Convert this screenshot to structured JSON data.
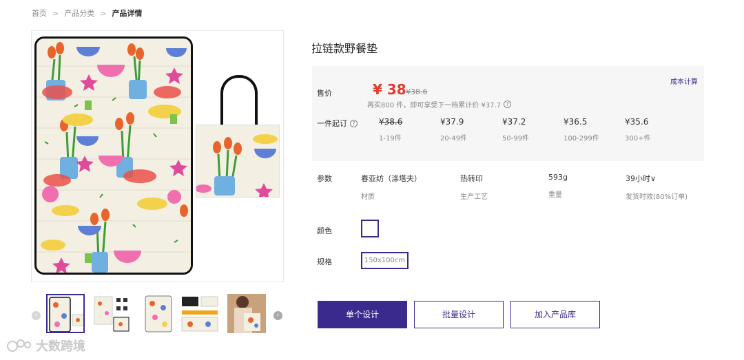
{
  "breadcrumb": {
    "home": "首页",
    "category": "产品分类",
    "current": "产品详情",
    "separator": ">"
  },
  "product": {
    "title": "拉链款野餐垫"
  },
  "price": {
    "label": "售价",
    "currency": "¥",
    "current": "38",
    "original": "38.6",
    "note": "再买800 件，即可享受下一档累计价 ¥37.7",
    "cost_link": "成本计算",
    "moq_label": "一件起订",
    "tiers": [
      {
        "price": "¥38.6",
        "qty": "1-19件"
      },
      {
        "price": "¥37.9",
        "qty": "20-49件"
      },
      {
        "price": "¥37.2",
        "qty": "50-99件"
      },
      {
        "price": "¥36.5",
        "qty": "100-299件"
      },
      {
        "price": "¥35.6",
        "qty": "300+件"
      }
    ]
  },
  "params": {
    "label": "参数",
    "items": [
      {
        "value": "春亚纺（涤塔夫）",
        "key": "材质"
      },
      {
        "value": "热转印",
        "key": "生产工艺"
      },
      {
        "value": "593g",
        "key": "重量"
      },
      {
        "value": "39小时∨",
        "key": "发货时效(80%订单)"
      }
    ]
  },
  "color": {
    "label": "颜色"
  },
  "spec": {
    "label": "规格",
    "option": "150x100cm"
  },
  "buttons": {
    "single_design": "单个设计",
    "batch_design": "批量设计",
    "add_library": "加入产品库"
  },
  "watermark": {
    "text": "大数跨境"
  },
  "colors": {
    "brand": "#3b2a8e",
    "price": "#e33b2e"
  }
}
